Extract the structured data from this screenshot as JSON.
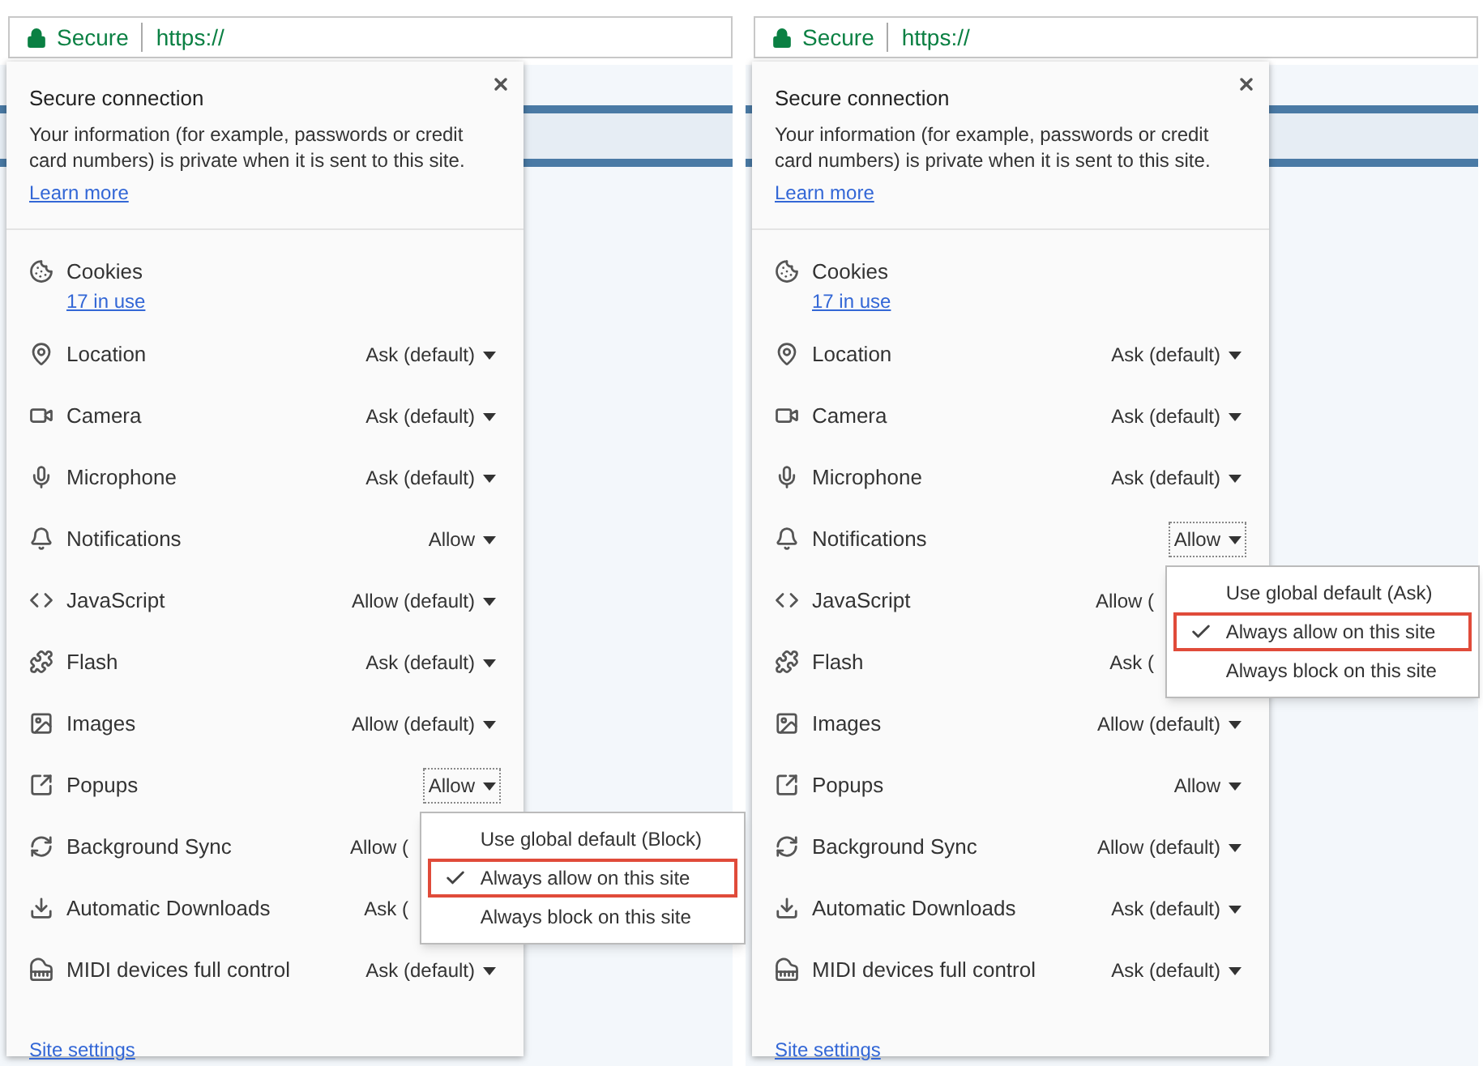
{
  "panels": [
    {
      "address_bar": {
        "security": "Secure",
        "url": "https://"
      },
      "popup": {
        "title": "Secure connection",
        "description": "Your information (for example, passwords or credit card numbers) is private when it is sent to this site.",
        "learn_more": "Learn more",
        "permissions": [
          {
            "label": "Cookies",
            "link": "17 in use"
          },
          {
            "label": "Location",
            "value": "Ask (default)",
            "caret": true,
            "open": false
          },
          {
            "label": "Camera",
            "value": "Ask (default)",
            "caret": true,
            "open": false
          },
          {
            "label": "Microphone",
            "value": "Ask (default)",
            "caret": true,
            "open": false
          },
          {
            "label": "Notifications",
            "value": "Allow",
            "caret": true,
            "open": false
          },
          {
            "label": "JavaScript",
            "value": "Allow (default)",
            "caret": true,
            "open": false
          },
          {
            "label": "Flash",
            "value": "Ask (default)",
            "caret": true,
            "open": false
          },
          {
            "label": "Images",
            "value": "Allow (default)",
            "caret": true,
            "open": false
          },
          {
            "label": "Popups",
            "value": "Allow",
            "caret": true,
            "open": true,
            "menu": [
              {
                "label": "Use global default (Block)",
                "selected": false,
                "highlighted": false
              },
              {
                "label": "Always allow on this site",
                "selected": true,
                "highlighted": true
              },
              {
                "label": "Always block on this site",
                "selected": false,
                "highlighted": false
              }
            ]
          },
          {
            "label": "Background Sync",
            "value": "Allow (",
            "caret": false,
            "open": false
          },
          {
            "label": "Automatic Downloads",
            "value": "Ask (",
            "caret": false,
            "open": false
          },
          {
            "label": "MIDI devices full control",
            "value": "Ask (default)",
            "caret": true,
            "open": false
          }
        ],
        "site_settings": "Site settings"
      }
    },
    {
      "address_bar": {
        "security": "Secure",
        "url": "https://"
      },
      "popup": {
        "title": "Secure connection",
        "description": "Your information (for example, passwords or credit card numbers) is private when it is sent to this site.",
        "learn_more": "Learn more",
        "permissions": [
          {
            "label": "Cookies",
            "link": "17 in use"
          },
          {
            "label": "Location",
            "value": "Ask (default)",
            "caret": true,
            "open": false
          },
          {
            "label": "Camera",
            "value": "Ask (default)",
            "caret": true,
            "open": false
          },
          {
            "label": "Microphone",
            "value": "Ask (default)",
            "caret": true,
            "open": false
          },
          {
            "label": "Notifications",
            "value": "Allow",
            "caret": true,
            "open": true,
            "menu": [
              {
                "label": "Use global default (Ask)",
                "selected": false,
                "highlighted": false
              },
              {
                "label": "Always allow on this site",
                "selected": true,
                "highlighted": true
              },
              {
                "label": "Always block on this site",
                "selected": false,
                "highlighted": false
              }
            ]
          },
          {
            "label": "JavaScript",
            "value": "Allow (",
            "caret": false,
            "open": false
          },
          {
            "label": "Flash",
            "value": "Ask (",
            "caret": false,
            "open": false
          },
          {
            "label": "Images",
            "value": "Allow (default)",
            "caret": true,
            "open": false
          },
          {
            "label": "Popups",
            "value": "Allow",
            "caret": true,
            "open": false
          },
          {
            "label": "Background Sync",
            "value": "Allow (default)",
            "caret": true,
            "open": false
          },
          {
            "label": "Automatic Downloads",
            "value": "Ask (default)",
            "caret": true,
            "open": false
          },
          {
            "label": "MIDI devices full control",
            "value": "Ask (default)",
            "caret": true,
            "open": false
          }
        ],
        "site_settings": "Site settings"
      }
    }
  ]
}
